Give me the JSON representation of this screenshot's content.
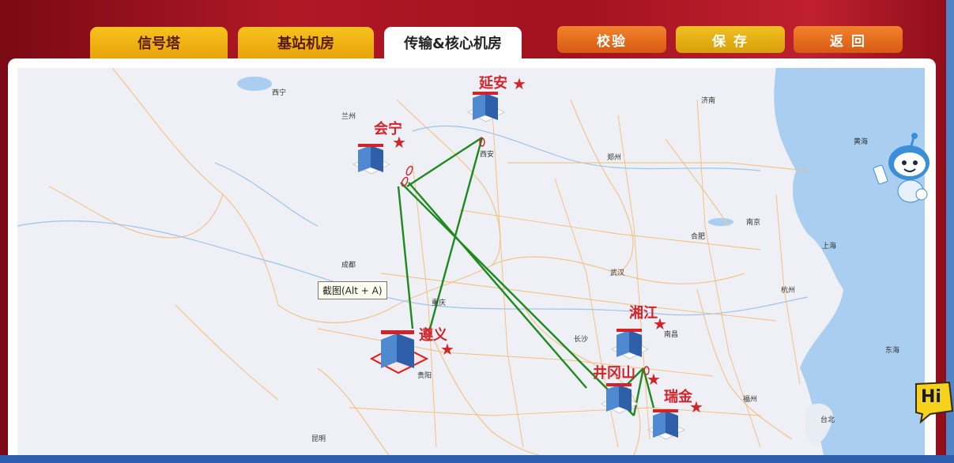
{
  "tabs": [
    {
      "label": "信号塔",
      "active": false
    },
    {
      "label": "基站机房",
      "active": false
    },
    {
      "label": "传输&核心机房",
      "active": true
    }
  ],
  "actions": {
    "verify": "校验",
    "save": "保 存",
    "back": "返 回"
  },
  "tooltip": "截图(Alt + A)",
  "hi_label": "Hi",
  "sites": [
    {
      "name": "延安"
    },
    {
      "name": "会宁"
    },
    {
      "name": "遵义"
    },
    {
      "name": "湘江"
    },
    {
      "name": "井冈山"
    },
    {
      "name": "瑞金"
    }
  ],
  "cities": {
    "xining": "西宁",
    "lanzhou": "兰州",
    "xian": "西安",
    "jinan": "济南",
    "zhengzhou": "郑州",
    "nanjing": "南京",
    "hefei": "合肥",
    "shanghai": "上海",
    "wuhan": "武汉",
    "chengdu": "成都",
    "chongqing": "重庆",
    "changsha": "长沙",
    "nanchang": "南昌",
    "hangzhou": "杭州",
    "guiyang": "贵阳",
    "fuzhou": "福州",
    "kunming": "昆明",
    "taibei": "台北",
    "huanghai": "黄海",
    "donghai": "东海"
  },
  "colors": {
    "accent": "#d2232a",
    "link": "#1e8a1e",
    "tab": "#f0b417",
    "frame": "#a3121f"
  }
}
